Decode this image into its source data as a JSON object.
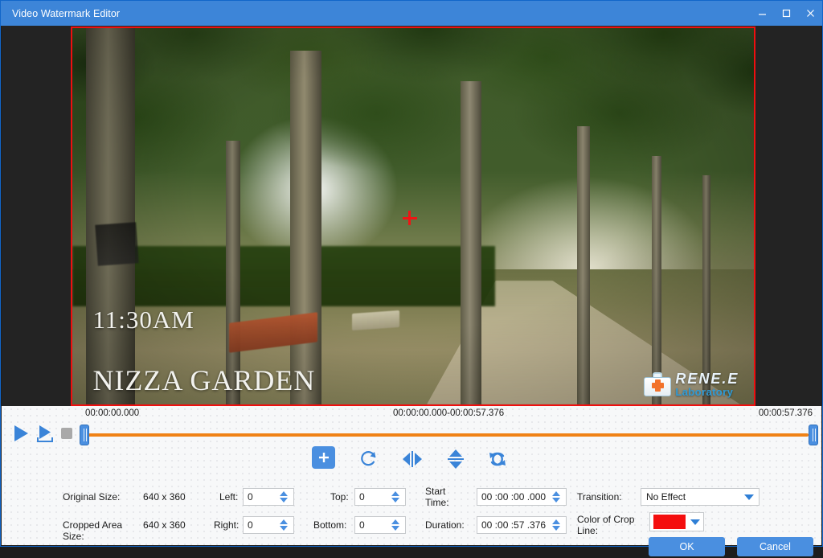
{
  "window": {
    "title": "Video Watermark Editor",
    "minimize_label": "minimize",
    "maximize_label": "maximize",
    "close_label": "close"
  },
  "preview": {
    "overlay_line1": "11:30AM",
    "overlay_line2": "NIZZA GARDEN",
    "watermark_line1": "RENE.E",
    "watermark_line2": "Laboratory",
    "crop_line_color": "#f40e0e"
  },
  "timeline": {
    "start_label": "00:00:00.000",
    "range_label": "00:00:00.000-00:00:57.376",
    "end_label": "00:00:57.376"
  },
  "transport": {
    "play_label": "Play",
    "play_selection_label": "Play selection",
    "stop_label": "Stop"
  },
  "toolbar": {
    "add_label": "Add",
    "rotate_label": "Rotate",
    "flip_horizontal_label": "Flip horizontal",
    "flip_vertical_label": "Flip vertical",
    "reset_label": "Reset rotation"
  },
  "form": {
    "original_size_label": "Original Size:",
    "original_size_value": "640 x 360",
    "cropped_area_label": "Cropped Area Size:",
    "cropped_area_value": "640 x 360",
    "left_label": "Left:",
    "left_value": "0",
    "right_label": "Right:",
    "right_value": "0",
    "top_label": "Top:",
    "top_value": "0",
    "bottom_label": "Bottom:",
    "bottom_value": "0",
    "start_time_label": "Start Time:",
    "start_time_value": "00 :00 :00 .000",
    "duration_label": "Duration:",
    "duration_value": "00 :00 :57 .376",
    "transition_label": "Transition:",
    "transition_value": "No Effect",
    "crop_line_color_label": "Color of Crop Line:"
  },
  "actions": {
    "ok_label": "OK",
    "cancel_label": "Cancel"
  },
  "theme": {
    "accent": "#3d85d8",
    "track": "#f08216",
    "crop_red": "#ef0f0f"
  }
}
